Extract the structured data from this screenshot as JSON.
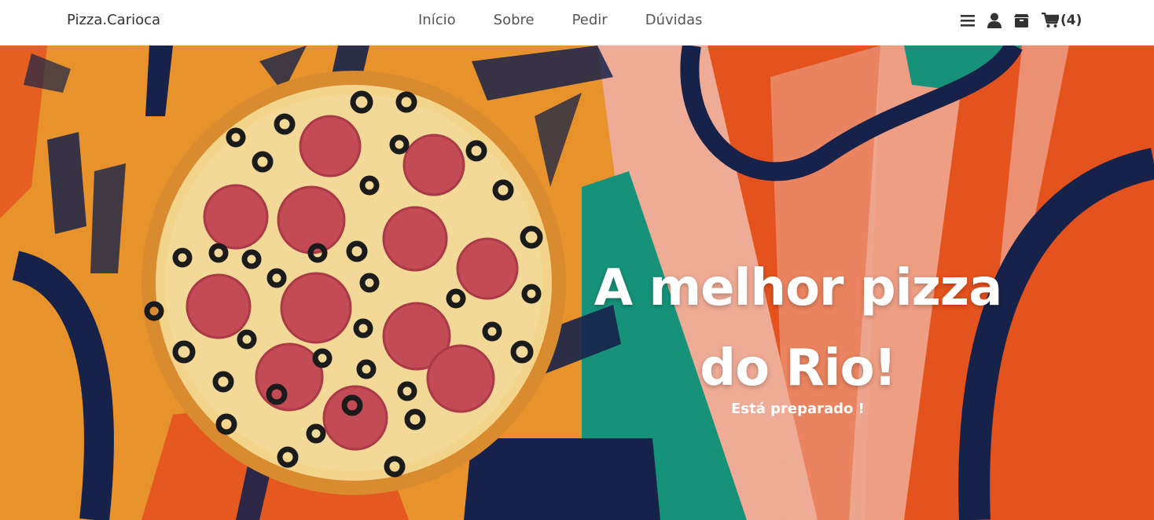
{
  "brand": "Pizza.Carioca",
  "nav": {
    "links": [
      "Início",
      "Sobre",
      "Pedir",
      "Dúvidas"
    ]
  },
  "icons": {
    "menu": "bars-icon",
    "user": "user-icon",
    "box": "box-icon",
    "cart": "cart-icon"
  },
  "cart": {
    "count": "(4)"
  },
  "hero": {
    "title_line1": "A melhor pizza",
    "title_line2": "do Rio!",
    "subtitle": "Está preparado !"
  },
  "colors": {
    "orange": "#e7922b",
    "red_orange": "#e4521e",
    "navy": "#17224a",
    "teal": "#16917a",
    "pink": "#eeab95",
    "cheese": "#f2d48a",
    "crust": "#d98b2f",
    "pepperoni": "#c34b56"
  }
}
